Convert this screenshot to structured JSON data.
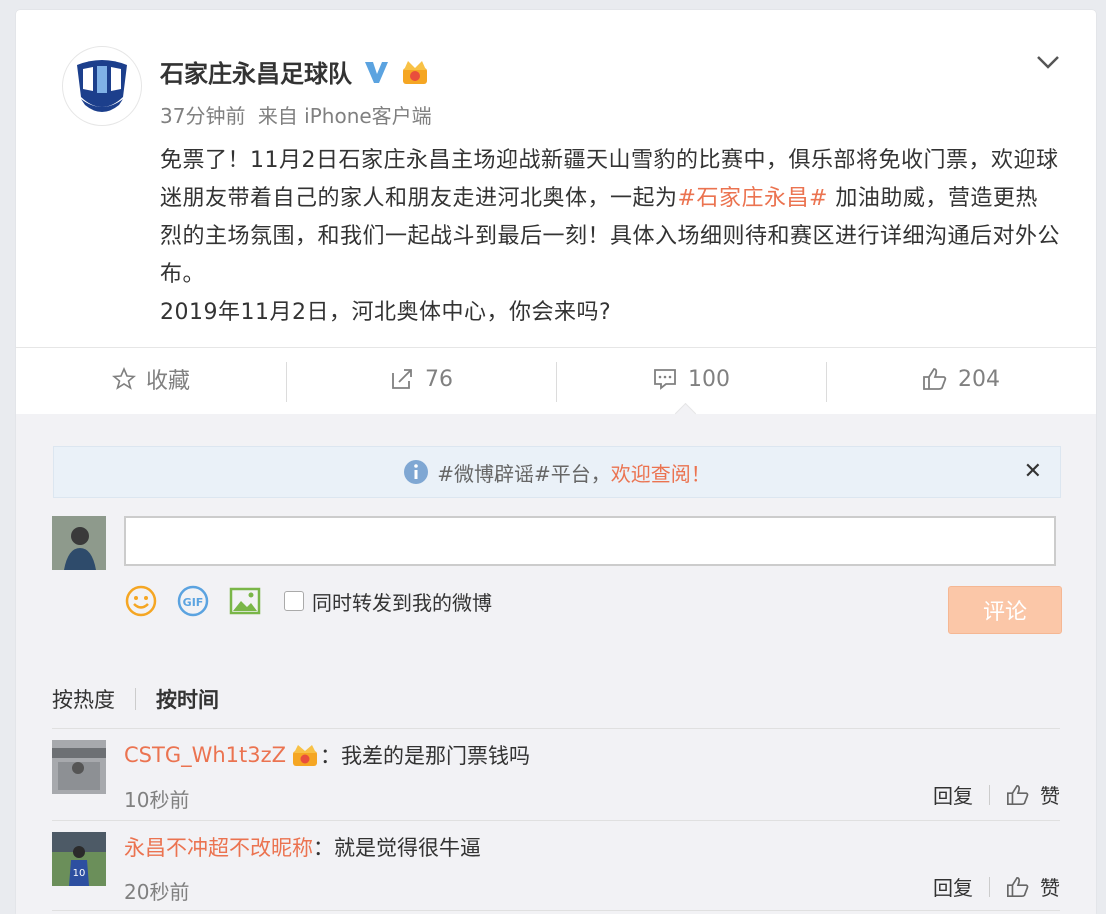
{
  "post": {
    "username": "石家庄永昌足球队",
    "time": "37分钟前",
    "source": "来自 iPhone客户端",
    "text_before": "免票了！11月2日石家庄永昌主场迎战新疆天山雪豹的比赛中，俱乐部将免收门票，欢迎球迷朋友带着自己的家人和朋友走进河北奥体，一起为",
    "topic": "#石家庄永昌#",
    "text_after": " 加油助威，营造更热烈的主场氛围，和我们一起战斗到最后一刻！具体入场细则待和赛区进行详细沟通后对外公布。",
    "line2": "2019年11月2日，河北奥体中心，你会来吗?"
  },
  "actions": {
    "favorite": "收藏",
    "repost": "76",
    "comments": "100",
    "likes": "204"
  },
  "notice": {
    "text": "#微博辟谣#平台，",
    "link": "欢迎查阅！"
  },
  "composer": {
    "forward_label": "同时转发到我的微博",
    "submit": "评论"
  },
  "sort": {
    "hot": "按热度",
    "time": "按时间"
  },
  "comments": [
    {
      "name": "CSTG_Wh1t3zZ",
      "text": "：我差的是那门票钱吗",
      "time": "10秒前",
      "reply": "回复",
      "like": "赞"
    },
    {
      "name": "永昌不冲超不改昵称",
      "text": "：就是觉得很牛逼",
      "time": "20秒前",
      "reply": "回复",
      "like": "赞"
    }
  ],
  "colors": {
    "accent": "#eb7350",
    "verified": "#5ba3e0",
    "crown": "#f5a623"
  }
}
